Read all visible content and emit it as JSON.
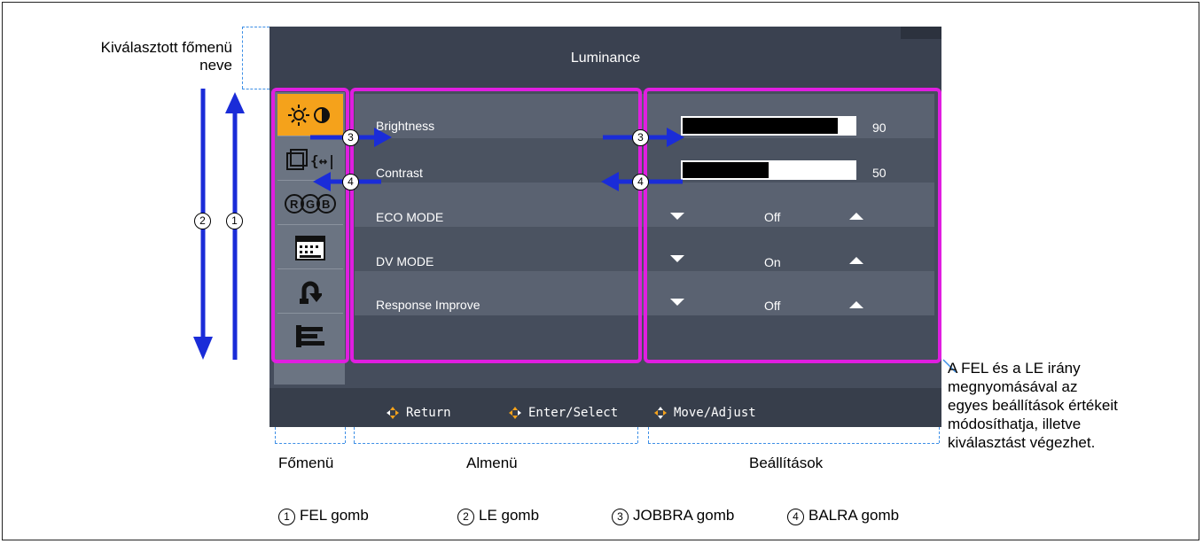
{
  "osd": {
    "title": "Luminance",
    "main_menu_icons": [
      "brightness-contrast-icon",
      "image-size-icon",
      "rgb-color-icon",
      "osd-menu-icon",
      "reset-icon",
      "tools-icon"
    ],
    "submenu": [
      {
        "label": "Brightness"
      },
      {
        "label": "Contrast"
      },
      {
        "label": "ECO MODE"
      },
      {
        "label": "DV MODE"
      },
      {
        "label": "Response Improve"
      }
    ],
    "settings": {
      "brightness": {
        "value": "90",
        "level": 0.9
      },
      "contrast": {
        "value": "50",
        "level": 0.5
      },
      "eco_mode": "Off",
      "dv_mode": "On",
      "response_improve": "Off"
    },
    "footer": {
      "return": "Return",
      "enter_select": "Enter/Select",
      "move_adjust": "Move/Adjust"
    }
  },
  "annotations": {
    "selected_menu_name_line1": "Kiválasztott főmenü",
    "selected_menu_name_line2": "neve",
    "main_menu": "Főmenü",
    "submenu": "Almenü",
    "settings": "Beállítások",
    "note_line1": "A FEL és a LE irány",
    "note_line2": "megnyomásával az",
    "note_line3": "egyes beállítások értékeit",
    "note_line4": "módosíthatja, illetve",
    "note_line5": "kiválasztást végezhet.",
    "num1": "1",
    "num2": "2",
    "num3": "3",
    "num4": "4"
  },
  "legend": {
    "up": "FEL gomb",
    "down": "LE gomb",
    "right": "JOBBRA gomb",
    "left": "BALRA gomb"
  },
  "colors": {
    "highlight": "#e01ee0",
    "arrow": "#1a2cd8",
    "active_icon": "#f5a21b",
    "dashed": "#3d8fe6"
  }
}
